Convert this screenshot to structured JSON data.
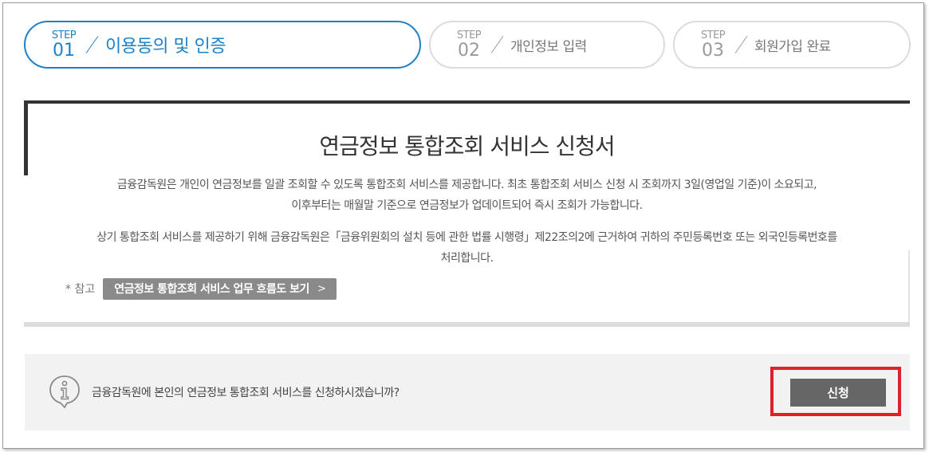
{
  "steps": [
    {
      "word": "STEP",
      "num": "01",
      "title": "이용동의 및 인증"
    },
    {
      "word": "STEP",
      "num": "02",
      "title": "개인정보 입력"
    },
    {
      "word": "STEP",
      "num": "03",
      "title": "회원가입 완료"
    }
  ],
  "document": {
    "title": "연금정보 통합조회 서비스 신청서",
    "para1_line1": "금융감독원은 개인이 연금정보를 일괄 조회할 수 있도록 통합조회 서비스를 제공합니다. 최초 통합조회 서비스 신청 시 조회까지 3일(영업일 기준)이 소요되고,",
    "para1_line2": "이후부터는 매월말 기준으로 연금정보가 업데이트되어 즉시 조회가 가능합니다.",
    "para2_line1": "상기 통합조회 서비스를 제공하기 위해 금융감독원은「금융위원회의 설치 등에 관한 법률 시행령」제22조의2에 근거하여 귀하의 주민등록번호 또는 외국인등록번호를",
    "para2_line2": "처리합니다.",
    "ref_label": "* 참고",
    "ref_button": "연금정보 통합조회 서비스 업무 흐름도 보기",
    "ref_chevron": ">"
  },
  "confirm": {
    "icon": "info-icon",
    "question": "금융감독원에 본인의 연금정보 통합조회 서비스를 신청하시겠습니까?",
    "apply_button": "신청"
  },
  "colors": {
    "accent": "#1e82c8",
    "highlight": "#e0202a",
    "button_dark": "#666666"
  }
}
